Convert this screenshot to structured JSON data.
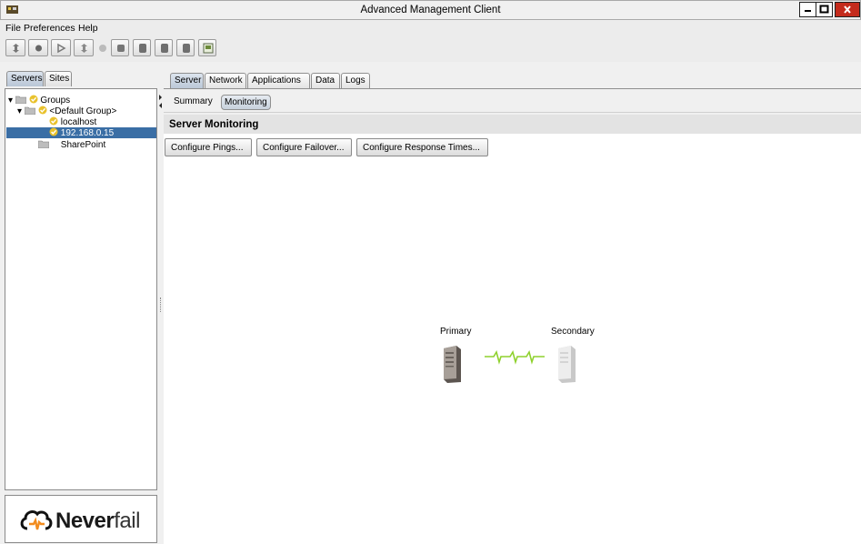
{
  "window": {
    "title": "Advanced Management Client"
  },
  "menu": [
    "File",
    "Preferences",
    "Help"
  ],
  "left_tabs": [
    "Servers",
    "Sites"
  ],
  "tree": {
    "root": "Groups",
    "group": "<Default Group>",
    "items": [
      "localhost",
      "192.168.0.15"
    ],
    "other": "SharePoint"
  },
  "logo": {
    "part1": "Never",
    "part2": "fail"
  },
  "right_tabs": [
    "Server",
    "Network",
    "Applications",
    "Data",
    "Logs"
  ],
  "sub_tabs": [
    "Summary",
    "Monitoring"
  ],
  "section_title": "Server Monitoring",
  "buttons": {
    "pings": "Configure Pings...",
    "failover": "Configure Failover...",
    "response": "Configure Response Times..."
  },
  "diagram": {
    "primary_label": "Primary",
    "secondary_label": "Secondary",
    "link_color": "#8fd12e"
  },
  "colors": {
    "selection": "#3a6ea5",
    "close": "#c42b1c"
  }
}
